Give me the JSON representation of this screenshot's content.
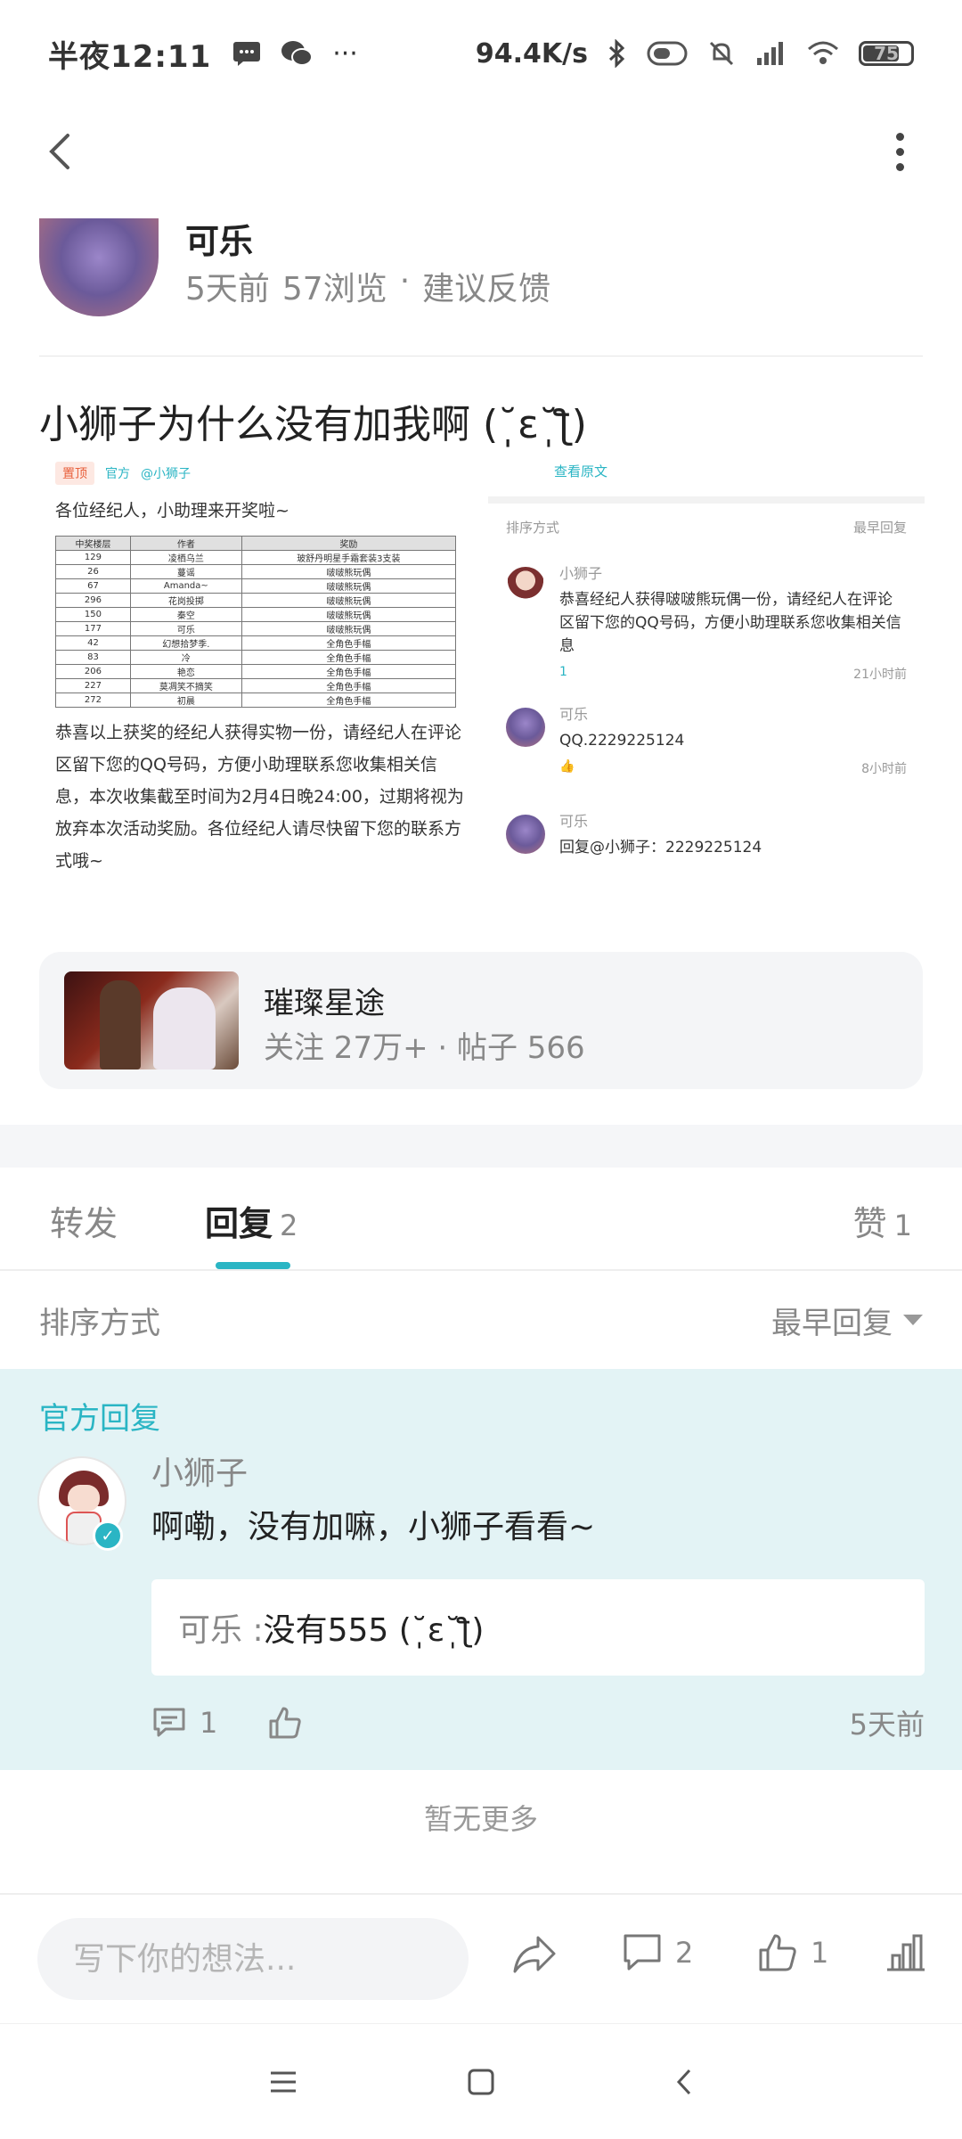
{
  "status_bar": {
    "time": "半夜12:11",
    "dots": "···",
    "speed": "94.4K/s",
    "battery": "75",
    "battery_level": 0.75
  },
  "author": {
    "name": "可乐",
    "time": "5天前",
    "views": "57浏览",
    "separator": "·",
    "category": "建议反馈"
  },
  "post": {
    "title": "小狮子为什么没有加我啊 (˘̩̩̩ε˘̩ƪ)"
  },
  "embed": {
    "tag_top": "置顶",
    "tag_official": "官方",
    "tag_at": "@小狮子",
    "greeting": "各位经纪人，小助理来开奖啦~",
    "table_headers": [
      "中奖楼层",
      "作者",
      "奖励"
    ],
    "table_rows": [
      [
        "129",
        "凌栖乌兰",
        "玻舒丹明星手霜套装3支装"
      ],
      [
        "26",
        "蔓谣",
        "啵啵熊玩偶"
      ],
      [
        "67",
        "Amanda~",
        "啵啵熊玩偶"
      ],
      [
        "296",
        "花岗投掷",
        "啵啵熊玩偶"
      ],
      [
        "150",
        "秦空",
        "啵啵熊玩偶"
      ],
      [
        "177",
        "可乐",
        "啵啵熊玩偶"
      ],
      [
        "42",
        "幻想拾梦季.",
        "全角色手幅"
      ],
      [
        "83",
        "冷",
        "全角色手幅"
      ],
      [
        "206",
        "艳恋",
        "全角色手幅"
      ],
      [
        "227",
        "莫凋笑不摘笑",
        "全角色手幅"
      ],
      [
        "272",
        "初晨",
        "全角色手幅"
      ]
    ],
    "paragraph": "恭喜以上获奖的经纪人获得实物一份，请经纪人在评论区留下您的QQ号码，方便小助理联系您收集相关信息，本次收集截至时间为2月4日晚24:00，过期将视为放弃本次活动奖励。各位经纪人请尽快留下您的联系方式哦~",
    "view_original": "查看原文",
    "sort_label": "排序方式",
    "sort_value": "最早回复",
    "comments": [
      {
        "name": "小狮子",
        "text": "恭喜经纪人获得啵啵熊玩偶一份，请经纪人在评论区留下您的QQ号码，方便小助理联系您收集相关信息",
        "likes": "1",
        "time": "21小时前"
      },
      {
        "name": "可乐",
        "text": "QQ.2229225124",
        "likes": "",
        "time": "8小时前"
      },
      {
        "name": "可乐",
        "text": "回复@小狮子：2229225124",
        "likes": "",
        "time": ""
      }
    ]
  },
  "forum": {
    "name": "璀璨星途",
    "meta": "关注 27万+ · 帖子 566"
  },
  "tabs": {
    "forward": "转发",
    "reply": "回复",
    "reply_count": "2",
    "like": "赞",
    "like_count": "1"
  },
  "sort": {
    "label": "排序方式",
    "value": "最早回复"
  },
  "official_reply": {
    "label": "官方回复",
    "name": "小狮子",
    "text": "啊嘞，没有加嘛，小狮子看看~",
    "quote_name": "可乐 : ",
    "quote_text": "没有555 (˘̩̩̩ε˘̩ƪ)",
    "comment_count": "1",
    "time": "5天前"
  },
  "no_more": "暂无更多",
  "bottom_bar": {
    "placeholder": "写下你的想法...",
    "comment_count": "2",
    "like_count": "1"
  },
  "colors": {
    "accent": "#2ab5c4",
    "official_bg": "#e3f3f5"
  }
}
